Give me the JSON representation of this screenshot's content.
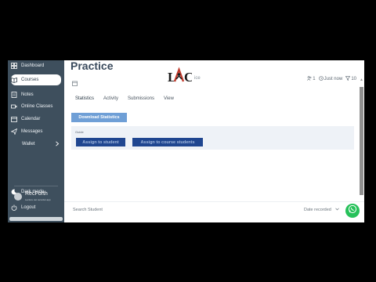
{
  "sidebar": {
    "items": [
      {
        "label": "Dashboard",
        "icon": "dashboard-icon"
      },
      {
        "label": "Courses",
        "icon": "book-icon",
        "active": true
      },
      {
        "label": "Notes",
        "icon": "notes-icon"
      },
      {
        "label": "Online Classes",
        "icon": "video-icon"
      },
      {
        "label": "Calendar",
        "icon": "calendar-icon"
      },
      {
        "label": "Messages",
        "icon": "send-icon"
      },
      {
        "label": "Wallet",
        "icon": "chevron-right-icon"
      }
    ],
    "dark_mode": "Dark mode",
    "logout": "Logout",
    "recorder_name": "RecForth",
    "recorder_url": "Lecture.net.recorder.app"
  },
  "page": {
    "title": "Practice",
    "subtitle_fragment": "ice",
    "logo_text": "LAC",
    "meta": {
      "users": "1",
      "time": "Just now",
      "count": "10"
    }
  },
  "tabs": [
    "Statistics",
    "Activity",
    "Submissions",
    "View"
  ],
  "actions": {
    "download": "Download Statistics",
    "panel_label": "Guide",
    "assign_student": "Assign to student",
    "assign_course": "Assign to course students"
  },
  "footer": {
    "search_placeholder": "Search Student",
    "date_select": "Date recorded"
  },
  "colors": {
    "sidebar_bg": "#3e4f5d",
    "primary_button": "#6f9fd6",
    "assign_button": "#1f4690",
    "whatsapp": "#27c15a"
  }
}
